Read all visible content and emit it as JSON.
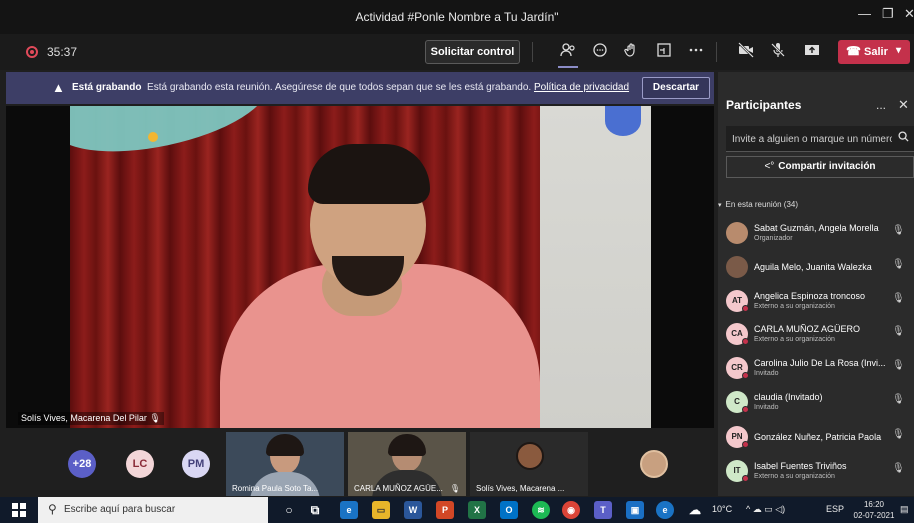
{
  "window": {
    "title": "Actividad #Ponle Nombre a Tu Jardín\"",
    "minimize": "—",
    "maximize": "❐",
    "close": "✕"
  },
  "toolbar": {
    "timer": "35:37",
    "control_label": "Solicitar control",
    "leave_label": "Salir",
    "icons": [
      "participants-icon",
      "chat-icon",
      "reactions-icon",
      "rooms-icon",
      "more-icon",
      "camera-off-icon",
      "mic-off-icon",
      "share-icon"
    ]
  },
  "banner": {
    "warning_glyph": "▲",
    "bold": "Está grabando",
    "text": "Está grabando esta reunión. Asegúrese de que todos sepan que se les está grabando.",
    "link": "Política de privacidad",
    "dismiss": "Descartar"
  },
  "main_video": {
    "name": "Solís Vives, Macarena Del Pilar"
  },
  "strip": {
    "overflow": "+28",
    "avatars": [
      {
        "initials": "LC",
        "color": "#f3d6d8"
      },
      {
        "initials": "PM",
        "color": "#d9d7f3"
      }
    ],
    "tiles": [
      {
        "label": "Romina Paula Soto Ta..."
      },
      {
        "label": "CARLA MUÑOZ AGÜE..."
      },
      {
        "label": "Solís Vives, Macarena ..."
      }
    ]
  },
  "panel": {
    "title": "Participantes",
    "more": "...",
    "close": "✕",
    "invite_placeholder": "Invite a alguien o marque un número",
    "share": "Compartir invitación",
    "section": "En esta reunión (34)",
    "participants": [
      {
        "initials": "",
        "photo": true,
        "name": "Sabat Guzmán, Angela Morella",
        "role": "Organizador",
        "status": false
      },
      {
        "initials": "",
        "photo": true,
        "name": "Aguila Melo, Juanita Walezka",
        "role": "",
        "status": false
      },
      {
        "initials": "AT",
        "photo": false,
        "color": "#f4c8cc",
        "name": "Angelica Espinoza troncoso",
        "role": "Externo a su organización",
        "status": true
      },
      {
        "initials": "CA",
        "photo": false,
        "color": "#f4c8cc",
        "name": "CARLA MUÑOZ AGÜERO",
        "role": "Externo a su organización",
        "status": true
      },
      {
        "initials": "CR",
        "photo": false,
        "color": "#f4c8cc",
        "name": "Carolina Julio De La Rosa (Invi...",
        "role": "Invitado",
        "status": true
      },
      {
        "initials": "C",
        "photo": false,
        "color": "#cfe8c8",
        "name": "claudia (Invitado)",
        "role": "Invitado",
        "status": true
      },
      {
        "initials": "PN",
        "photo": false,
        "color": "#f4c8cc",
        "name": "González Nuñez, Patricia Paola",
        "role": "",
        "status": true
      },
      {
        "initials": "IT",
        "photo": false,
        "color": "#cfe8c8",
        "name": "Isabel Fuentes Triviños",
        "role": "Externo a su organización",
        "status": true
      }
    ]
  },
  "taskbar": {
    "search_text": "Escribe aquí para buscar",
    "temperature": "10°C",
    "language": "ESP",
    "time": "16:20",
    "date": "02-07-2021"
  }
}
